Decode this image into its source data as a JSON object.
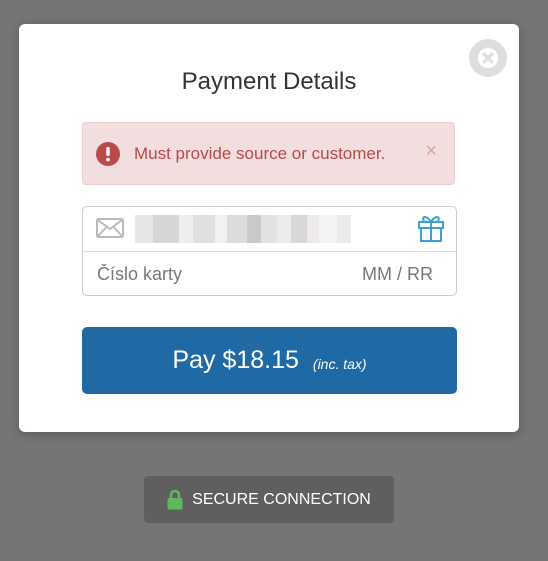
{
  "modal": {
    "title": "Payment Details",
    "close_icon": "close-icon"
  },
  "alert": {
    "icon": "exclamation-circle-icon",
    "message": "Must provide source or customer.",
    "close_label": "×",
    "color": "#b94a48",
    "background": "#f2dede"
  },
  "form": {
    "email_icon": "envelope-icon",
    "email_value": "",
    "gift_icon": "gift-icon",
    "card_number_placeholder": "Číslo karty",
    "expiry_placeholder": "MM / RR"
  },
  "pay_button": {
    "label": "Pay $18.15",
    "tax_note": "(inc. tax)",
    "color": "#1f6aa5"
  },
  "secure_badge": {
    "icon": "lock-icon",
    "label": "SECURE CONNECTION",
    "icon_color": "#5cb85c"
  }
}
